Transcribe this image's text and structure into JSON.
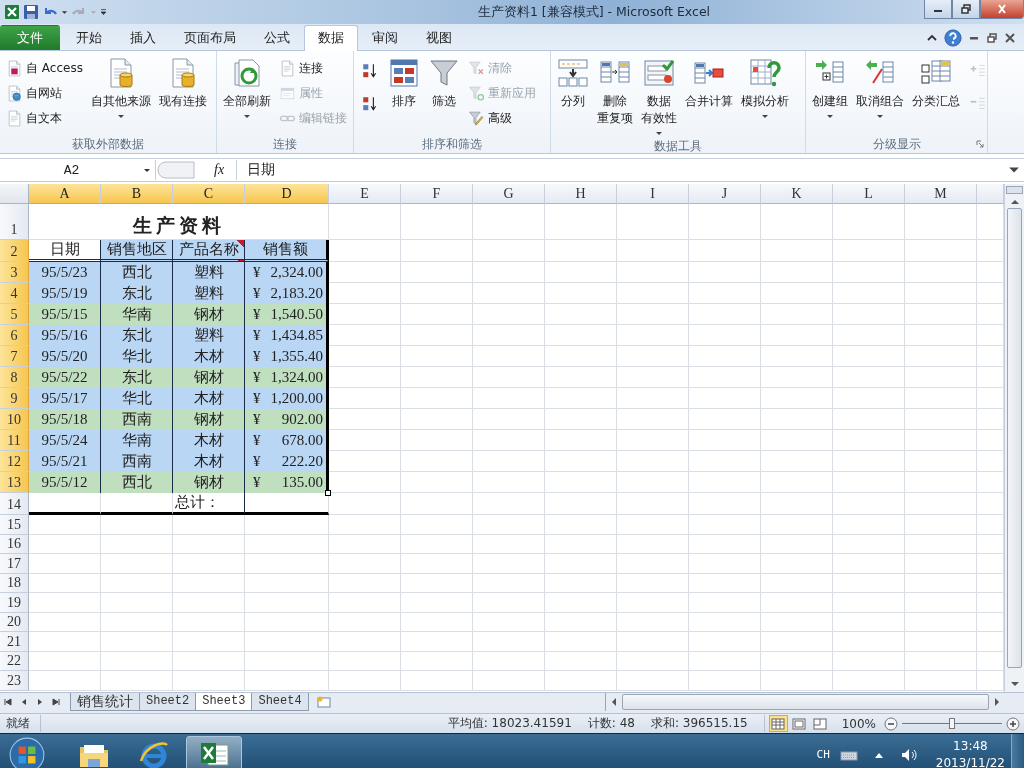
{
  "window": {
    "title": "生产资料1 [兼容模式] - Microsoft Excel"
  },
  "tabs": [
    {
      "label": "文件",
      "kind": "file",
      "selected": false
    },
    {
      "label": "开始",
      "kind": "tab",
      "selected": false
    },
    {
      "label": "插入",
      "kind": "tab",
      "selected": false
    },
    {
      "label": "页面布局",
      "kind": "tab",
      "selected": false
    },
    {
      "label": "公式",
      "kind": "tab",
      "selected": false
    },
    {
      "label": "数据",
      "kind": "tab",
      "selected": true
    },
    {
      "label": "审阅",
      "kind": "tab",
      "selected": false
    },
    {
      "label": "视图",
      "kind": "tab",
      "selected": false
    }
  ],
  "ribbon": [
    {
      "label": "获取外部数据",
      "launcher": false,
      "items": [
        {
          "label": "自 Access",
          "kind": "small",
          "disabled": false
        },
        {
          "label": "自网站",
          "kind": "small",
          "disabled": false
        },
        {
          "label": "自文本",
          "kind": "small",
          "disabled": false
        },
        {
          "label": "自其他来源",
          "kind": "large",
          "disabled": false,
          "dropdown": true
        },
        {
          "label": "现有连接",
          "kind": "large",
          "disabled": false,
          "dropdown": false
        }
      ]
    },
    {
      "label": "连接",
      "launcher": false,
      "items": [
        {
          "label": "全部刷新",
          "kind": "large",
          "disabled": false,
          "dropdown": true
        },
        {
          "label": "连接",
          "kind": "small",
          "disabled": false
        },
        {
          "label": "属性",
          "kind": "small",
          "disabled": true
        },
        {
          "label": "编辑链接",
          "kind": "small",
          "disabled": true
        }
      ]
    },
    {
      "label": "排序和筛选",
      "launcher": false,
      "items": [
        {
          "kind": "icon",
          "disabled": false
        },
        {
          "kind": "icon",
          "disabled": false
        },
        {
          "label": "排序",
          "kind": "large",
          "disabled": false,
          "dropdown": false
        },
        {
          "label": "筛选",
          "kind": "large",
          "disabled": false,
          "dropdown": false
        },
        {
          "label": "清除",
          "kind": "small",
          "disabled": true
        },
        {
          "label": "重新应用",
          "kind": "small",
          "disabled": true
        },
        {
          "label": "高级",
          "kind": "small",
          "disabled": false
        }
      ]
    },
    {
      "label": "数据工具",
      "launcher": false,
      "items": [
        {
          "label": "分列",
          "kind": "large",
          "disabled": false,
          "dropdown": false
        },
        {
          "lines": [
            "删除",
            "重复项"
          ],
          "kind": "large",
          "disabled": false,
          "dropdown": false
        },
        {
          "lines": [
            "数据",
            "有效性"
          ],
          "kind": "large",
          "disabled": false,
          "dropdown": true
        },
        {
          "label": "合并计算",
          "kind": "large",
          "disabled": false,
          "dropdown": false
        },
        {
          "label": "模拟分析",
          "kind": "large",
          "disabled": false,
          "dropdown": true
        }
      ]
    },
    {
      "label": "分级显示",
      "launcher": true,
      "items": [
        {
          "label": "创建组",
          "kind": "large",
          "disabled": false,
          "dropdown": true
        },
        {
          "label": "取消组合",
          "kind": "large",
          "disabled": false,
          "dropdown": true
        },
        {
          "label": "分类汇总",
          "kind": "large",
          "disabled": false,
          "dropdown": false
        },
        {
          "kind": "icon",
          "disabled": true
        },
        {
          "kind": "icon",
          "disabled": true
        }
      ]
    }
  ],
  "name_box": "A2",
  "fx": "fx",
  "formula": "日期",
  "sheet": {
    "column_headers": [
      {
        "label": "A",
        "selected": true
      },
      {
        "label": "B",
        "selected": true
      },
      {
        "label": "C",
        "selected": true
      },
      {
        "label": "D",
        "selected": true
      },
      {
        "label": "E",
        "selected": false
      },
      {
        "label": "F",
        "selected": false
      },
      {
        "label": "G",
        "selected": false
      },
      {
        "label": "H",
        "selected": false
      },
      {
        "label": "I",
        "selected": false
      },
      {
        "label": "J",
        "selected": false
      },
      {
        "label": "K",
        "selected": false
      },
      {
        "label": "L",
        "selected": false
      },
      {
        "label": "M",
        "selected": false
      }
    ],
    "row_headers": [
      {
        "label": "1",
        "selected": false
      },
      {
        "label": "2",
        "selected": true
      },
      {
        "label": "3",
        "selected": true
      },
      {
        "label": "4",
        "selected": true
      },
      {
        "label": "5",
        "selected": true
      },
      {
        "label": "6",
        "selected": true
      },
      {
        "label": "7",
        "selected": true
      },
      {
        "label": "8",
        "selected": true
      },
      {
        "label": "9",
        "selected": true
      },
      {
        "label": "10",
        "selected": true
      },
      {
        "label": "11",
        "selected": true
      },
      {
        "label": "12",
        "selected": true
      },
      {
        "label": "13",
        "selected": true
      },
      {
        "label": "14",
        "selected": false
      },
      {
        "label": "15",
        "selected": false
      },
      {
        "label": "16",
        "selected": false
      },
      {
        "label": "17",
        "selected": false
      },
      {
        "label": "18",
        "selected": false
      },
      {
        "label": "19",
        "selected": false
      },
      {
        "label": "20",
        "selected": false
      },
      {
        "label": "21",
        "selected": false
      },
      {
        "label": "22",
        "selected": false
      },
      {
        "label": "23",
        "selected": false
      }
    ],
    "title": "生产资料",
    "header": [
      {
        "text": "日期",
        "active": true,
        "comment": false
      },
      {
        "text": "销售地区",
        "active": false,
        "comment": false
      },
      {
        "text": "产品名称",
        "active": false,
        "comment": true
      },
      {
        "text": "销售额",
        "active": false,
        "comment": false
      }
    ],
    "rows": [
      {
        "date": "95/5/23",
        "region": "西北",
        "product": "塑料",
        "currency": "¥",
        "amount": "2,324.00",
        "color": "#b9d6f4"
      },
      {
        "date": "95/5/19",
        "region": "东北",
        "product": "塑料",
        "currency": "¥",
        "amount": "2,183.20",
        "color": "#b9d6f4"
      },
      {
        "date": "95/5/15",
        "region": "华南",
        "product": "钢材",
        "currency": "¥",
        "amount": "1,540.50",
        "color": "#c0dfbf"
      },
      {
        "date": "95/5/16",
        "region": "东北",
        "product": "塑料",
        "currency": "¥",
        "amount": "1,434.85",
        "color": "#b9d6f4"
      },
      {
        "date": "95/5/20",
        "region": "华北",
        "product": "木材",
        "currency": "¥",
        "amount": "1,355.40",
        "color": "#b9d6f4"
      },
      {
        "date": "95/5/22",
        "region": "东北",
        "product": "钢材",
        "currency": "¥",
        "amount": "1,324.00",
        "color": "#c0dfbf"
      },
      {
        "date": "95/5/17",
        "region": "华北",
        "product": "木材",
        "currency": "¥",
        "amount": "1,200.00",
        "color": "#b9d6f4"
      },
      {
        "date": "95/5/18",
        "region": "西南",
        "product": "钢材",
        "currency": "¥",
        "amount": "902.00",
        "color": "#c0dfbf"
      },
      {
        "date": "95/5/24",
        "region": "华南",
        "product": "木材",
        "currency": "¥",
        "amount": "678.00",
        "color": "#b9d6f4"
      },
      {
        "date": "95/5/21",
        "region": "西南",
        "product": "木材",
        "currency": "¥",
        "amount": "222.20",
        "color": "#b9d6f4"
      },
      {
        "date": "95/5/12",
        "region": "西北",
        "product": "钢材",
        "currency": "¥",
        "amount": "135.00",
        "color": "#c0dfbf"
      }
    ],
    "total_label": "总计："
  },
  "sheet_tabs": [
    {
      "label": "销售统计",
      "selected": false
    },
    {
      "label": "Sheet2",
      "selected": false
    },
    {
      "label": "Sheet3",
      "selected": true
    },
    {
      "label": "Sheet4",
      "selected": false
    }
  ],
  "status_bar": {
    "ready": "就绪",
    "stats": [
      "平均值: 18023.41591",
      "计数: 48",
      "求和: 396515.15"
    ],
    "views": [
      {
        "selected": true
      },
      {
        "selected": false
      },
      {
        "selected": false
      }
    ],
    "zoom": "100%",
    "zoom_slider": {
      "level": 0.5
    }
  },
  "taskbar": {
    "apps": [
      {
        "selected": false
      },
      {
        "selected": false
      },
      {
        "selected": true
      }
    ],
    "language": "CH",
    "time": "13:48",
    "date": "2013/11/22"
  }
}
